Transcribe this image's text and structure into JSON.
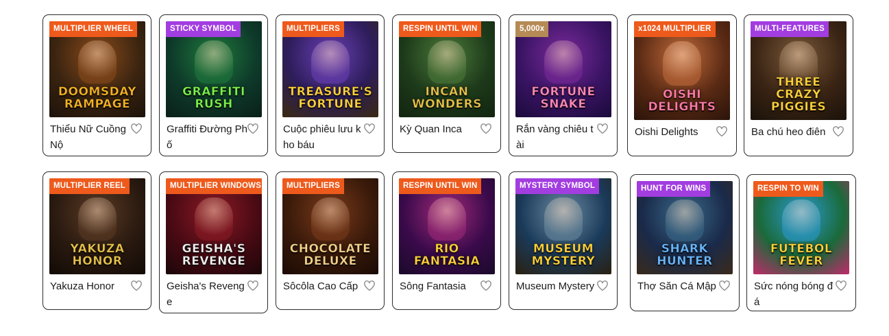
{
  "games": [
    {
      "badge": "MULTIPLIER WHEEL",
      "badge_color": "orange",
      "title": "Thiểu Nữ Cuồng Nộ",
      "logo": "DOOMSDAY RAMPAGE",
      "logo_color": "#f5b324",
      "bg": [
        "#3a2410",
        "#8a4a1a",
        "#1c120a"
      ]
    },
    {
      "badge": "STICKY SYMBOL",
      "badge_color": "purple",
      "title": "Graffiti Đường Phố",
      "logo": "GRAFFITI RUSH",
      "logo_color": "#7cf04a",
      "bg": [
        "#0e3a2a",
        "#1f7a3c",
        "#0a1f18"
      ]
    },
    {
      "badge": "MULTIPLIERS",
      "badge_color": "orange",
      "title": "Cuộc phiêu lưu kho báu",
      "logo": "TREASURE'S FORTUNE",
      "logo_color": "#ffd23a",
      "bg": [
        "#2d1d5a",
        "#6a3fb5",
        "#3a2a10"
      ]
    },
    {
      "badge": "RESPIN UNTIL WIN",
      "badge_color": "orange",
      "title": "Kỳ Quan Inca",
      "logo": "INCAN WONDERS",
      "logo_color": "#e8c24a",
      "bg": [
        "#1d3a1a",
        "#4d7a3a",
        "#122410"
      ]
    },
    {
      "badge": "5,000x",
      "badge_color": "tan",
      "title": "Rắn vàng chiêu tài",
      "logo": "FORTUNE SNAKE",
      "logo_color": "#ff8ab8",
      "bg": [
        "#3a1464",
        "#7a2a9a",
        "#1a0a3a"
      ]
    },
    {
      "badge": "x1024 MULTIPLIER",
      "badge_color": "orange",
      "title": "Oishi Delights",
      "logo": "OISHI DELIGHTS",
      "logo_color": "#ff7aa8",
      "bg": [
        "#5a2a14",
        "#c06a3a",
        "#2a140a"
      ]
    },
    {
      "badge": "MULTI-FEATURES",
      "badge_color": "purple",
      "title": "Ba chú heo điên",
      "logo": "THREE CRAZY PIGGIES",
      "logo_color": "#ffd23a",
      "bg": [
        "#3a2414",
        "#7a5a3a",
        "#1a120a"
      ]
    },
    {
      "badge": "MULTIPLIER REEL",
      "badge_color": "orange",
      "title": "Yakuza Honor",
      "logo": "YAKUZA HONOR",
      "logo_color": "#e8c24a",
      "bg": [
        "#2a1a10",
        "#5a3a24",
        "#120a06"
      ]
    },
    {
      "badge": "MULTIPLIER WINDOWS",
      "badge_color": "orange",
      "title": "Geisha's Revenge",
      "logo": "GEISHA'S REVENGE",
      "logo_color": "#f2f2f2",
      "bg": [
        "#4a0a14",
        "#8a1a24",
        "#1a0608"
      ]
    },
    {
      "badge": "MULTIPLIERS",
      "badge_color": "orange",
      "title": "Sôcôla Cao Cấp",
      "logo": "CHOCOLATE DELUXE",
      "logo_color": "#f5d28a",
      "bg": [
        "#3a1a0a",
        "#7a3a1a",
        "#1a0a04"
      ]
    },
    {
      "badge": "RESPIN UNTIL WIN",
      "badge_color": "orange",
      "title": "Sông Fantasia",
      "logo": "RIO FANTASIA",
      "logo_color": "#ffd23a",
      "bg": [
        "#3a0a4a",
        "#a02a7a",
        "#1a0a2a"
      ]
    },
    {
      "badge": "MYSTERY SYMBOL",
      "badge_color": "purple",
      "title": "Museum Mystery",
      "logo": "MUSEUM MYSTERY",
      "logo_color": "#ffd23a",
      "bg": [
        "#1a3a5a",
        "#6a8aa0",
        "#2a2010"
      ]
    },
    {
      "badge": "HUNT FOR WINS",
      "badge_color": "purple",
      "title": "Thợ Săn Cá Mập",
      "logo": "SHARK HUNTER",
      "logo_color": "#6ab8ff",
      "bg": [
        "#1a2a4a",
        "#3a6a8a",
        "#3a2a1a"
      ]
    },
    {
      "badge": "RESPIN TO WIN",
      "badge_color": "orange",
      "title": "Sức nóng bóng đá",
      "logo": "FUTEBOL FEVER",
      "logo_color": "#ffd23a",
      "bg": [
        "#1a6a3a",
        "#2a9ad0",
        "#c02a6a"
      ]
    }
  ]
}
